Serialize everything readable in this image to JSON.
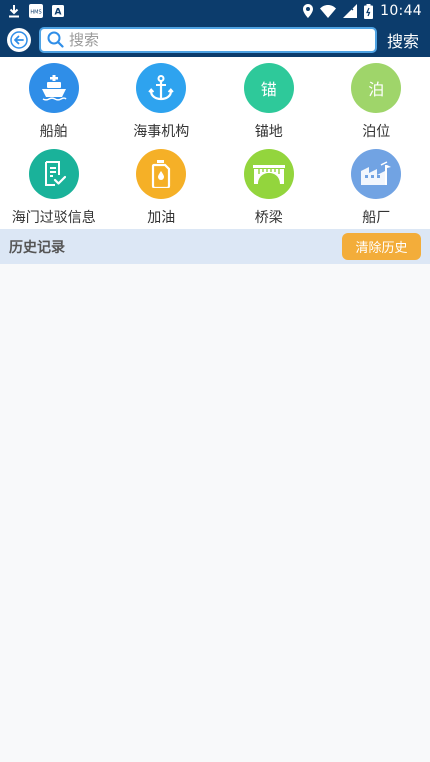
{
  "status_bar": {
    "time": "10:44",
    "left_icons": [
      "download-icon",
      "hms-app-icon",
      "a-app-icon"
    ],
    "right_icons": [
      "location-icon",
      "wifi-icon",
      "signal-icon",
      "battery-icon"
    ],
    "hms_text": "HMS",
    "a_text": "A"
  },
  "header": {
    "search_placeholder": "搜索",
    "search_value": "",
    "search_button": "搜索"
  },
  "categories": [
    {
      "label": "船舶",
      "icon": "ship-icon",
      "color": "#2f8ee8",
      "glyph": ""
    },
    {
      "label": "海事机构",
      "icon": "anchor-icon",
      "color": "#2ea3ef",
      "glyph": ""
    },
    {
      "label": "锚地",
      "icon": "anchorage-icon",
      "color": "#2ec99a",
      "glyph": "锚"
    },
    {
      "label": "泊位",
      "icon": "berth-icon",
      "color": "#9fd56a",
      "glyph": "泊"
    },
    {
      "label": "海门过驳信息",
      "icon": "document-check-icon",
      "color": "#1ab29a",
      "glyph": ""
    },
    {
      "label": "加油",
      "icon": "fuel-can-icon",
      "color": "#f5b027",
      "glyph": ""
    },
    {
      "label": "桥梁",
      "icon": "bridge-icon",
      "color": "#93d53d",
      "glyph": ""
    },
    {
      "label": "船厂",
      "icon": "shipyard-icon",
      "color": "#71a3e3",
      "glyph": ""
    }
  ],
  "history": {
    "title": "历史记录",
    "clear_label": "清除历史"
  },
  "colors": {
    "header": "#0c3c6c",
    "history_bar": "#dce7f5",
    "clear_button": "#f3ad3a"
  }
}
